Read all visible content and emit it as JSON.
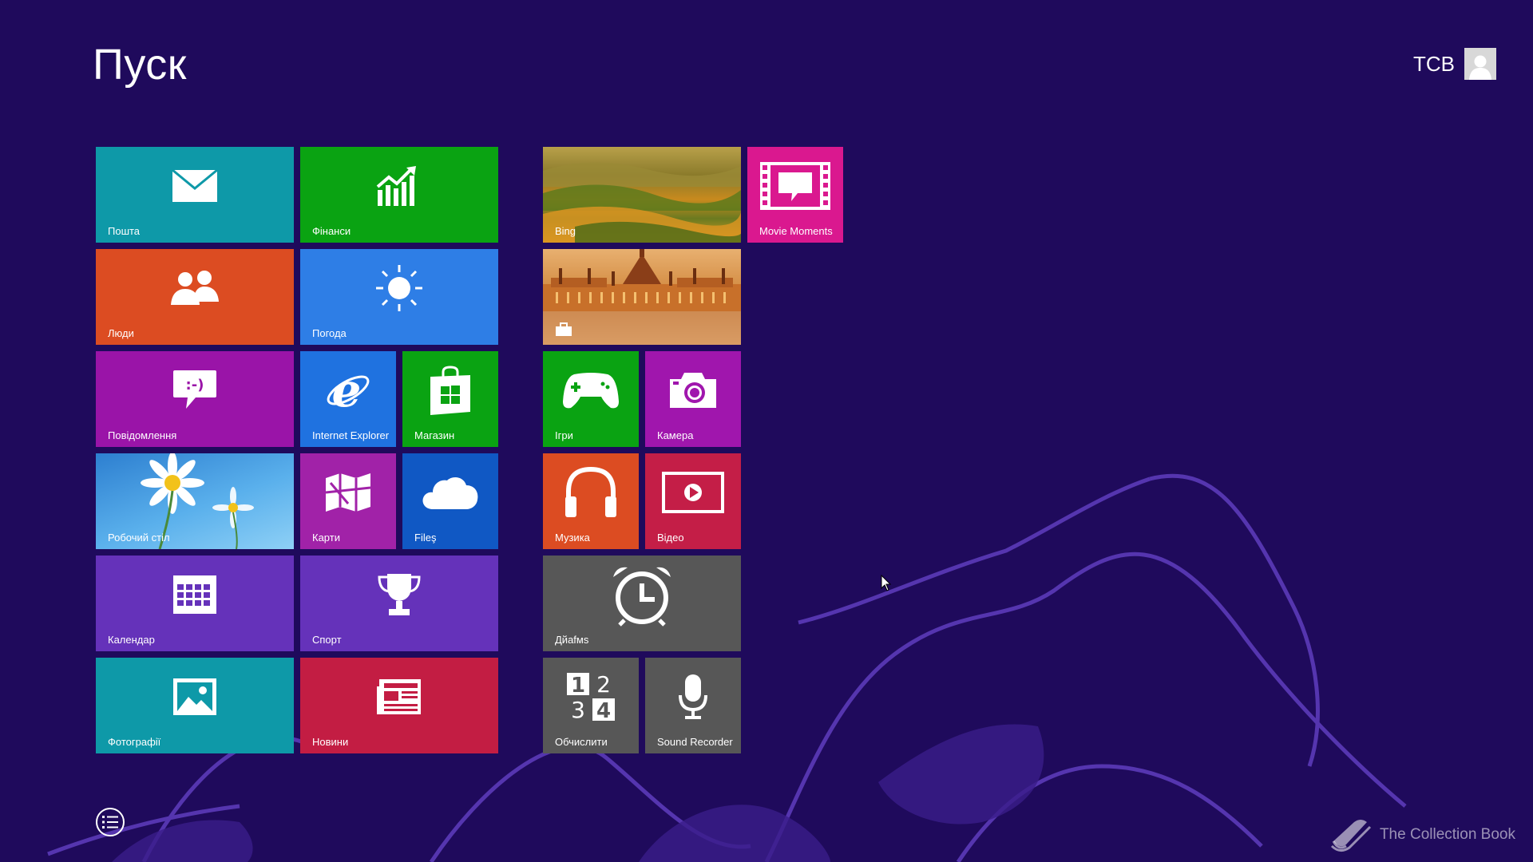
{
  "header": {
    "title": "Пуск",
    "user_name": "TCB"
  },
  "tiles": {
    "mail": "Пошта",
    "finance": "Фінанси",
    "people": "Люди",
    "weather": "Погода",
    "messaging": "Повідомлення",
    "ie": "Internet Explorer",
    "store": "Магазин",
    "desktop": "Робочий стіл",
    "maps": "Карти",
    "files": "Fileş",
    "calendar": "Календар",
    "sport": "Спорт",
    "photos": "Фотографії",
    "news": "Новини",
    "bing": "Bing",
    "movie": "Movie Moments",
    "games": "Ігри",
    "camera": "Камера",
    "music": "Музика",
    "video": "Відео",
    "alarms": "Дйafмs",
    "calculator": "Обчислити",
    "recorder": "Sound Recorder"
  },
  "colors": {
    "background": "#1f0a5c",
    "teal": "#0e99a8",
    "green": "#0aa312",
    "orange": "#dc4c22",
    "blue": "#2e7ee6",
    "purple": "#9a14a8",
    "ie_blue": "#1f72e0",
    "store_green": "#0aa312",
    "maps_purple": "#a122a8",
    "files_blue": "#1058c4",
    "violet": "#6532ba",
    "news_red": "#c31d43",
    "magenta": "#da188f",
    "camera_purple": "#a016ad",
    "video_red": "#c41e47",
    "gray": "#575757"
  },
  "icons": {
    "all_apps": "list-icon",
    "watermark": "book-icon"
  },
  "watermark": {
    "text": "The Collection Book"
  }
}
